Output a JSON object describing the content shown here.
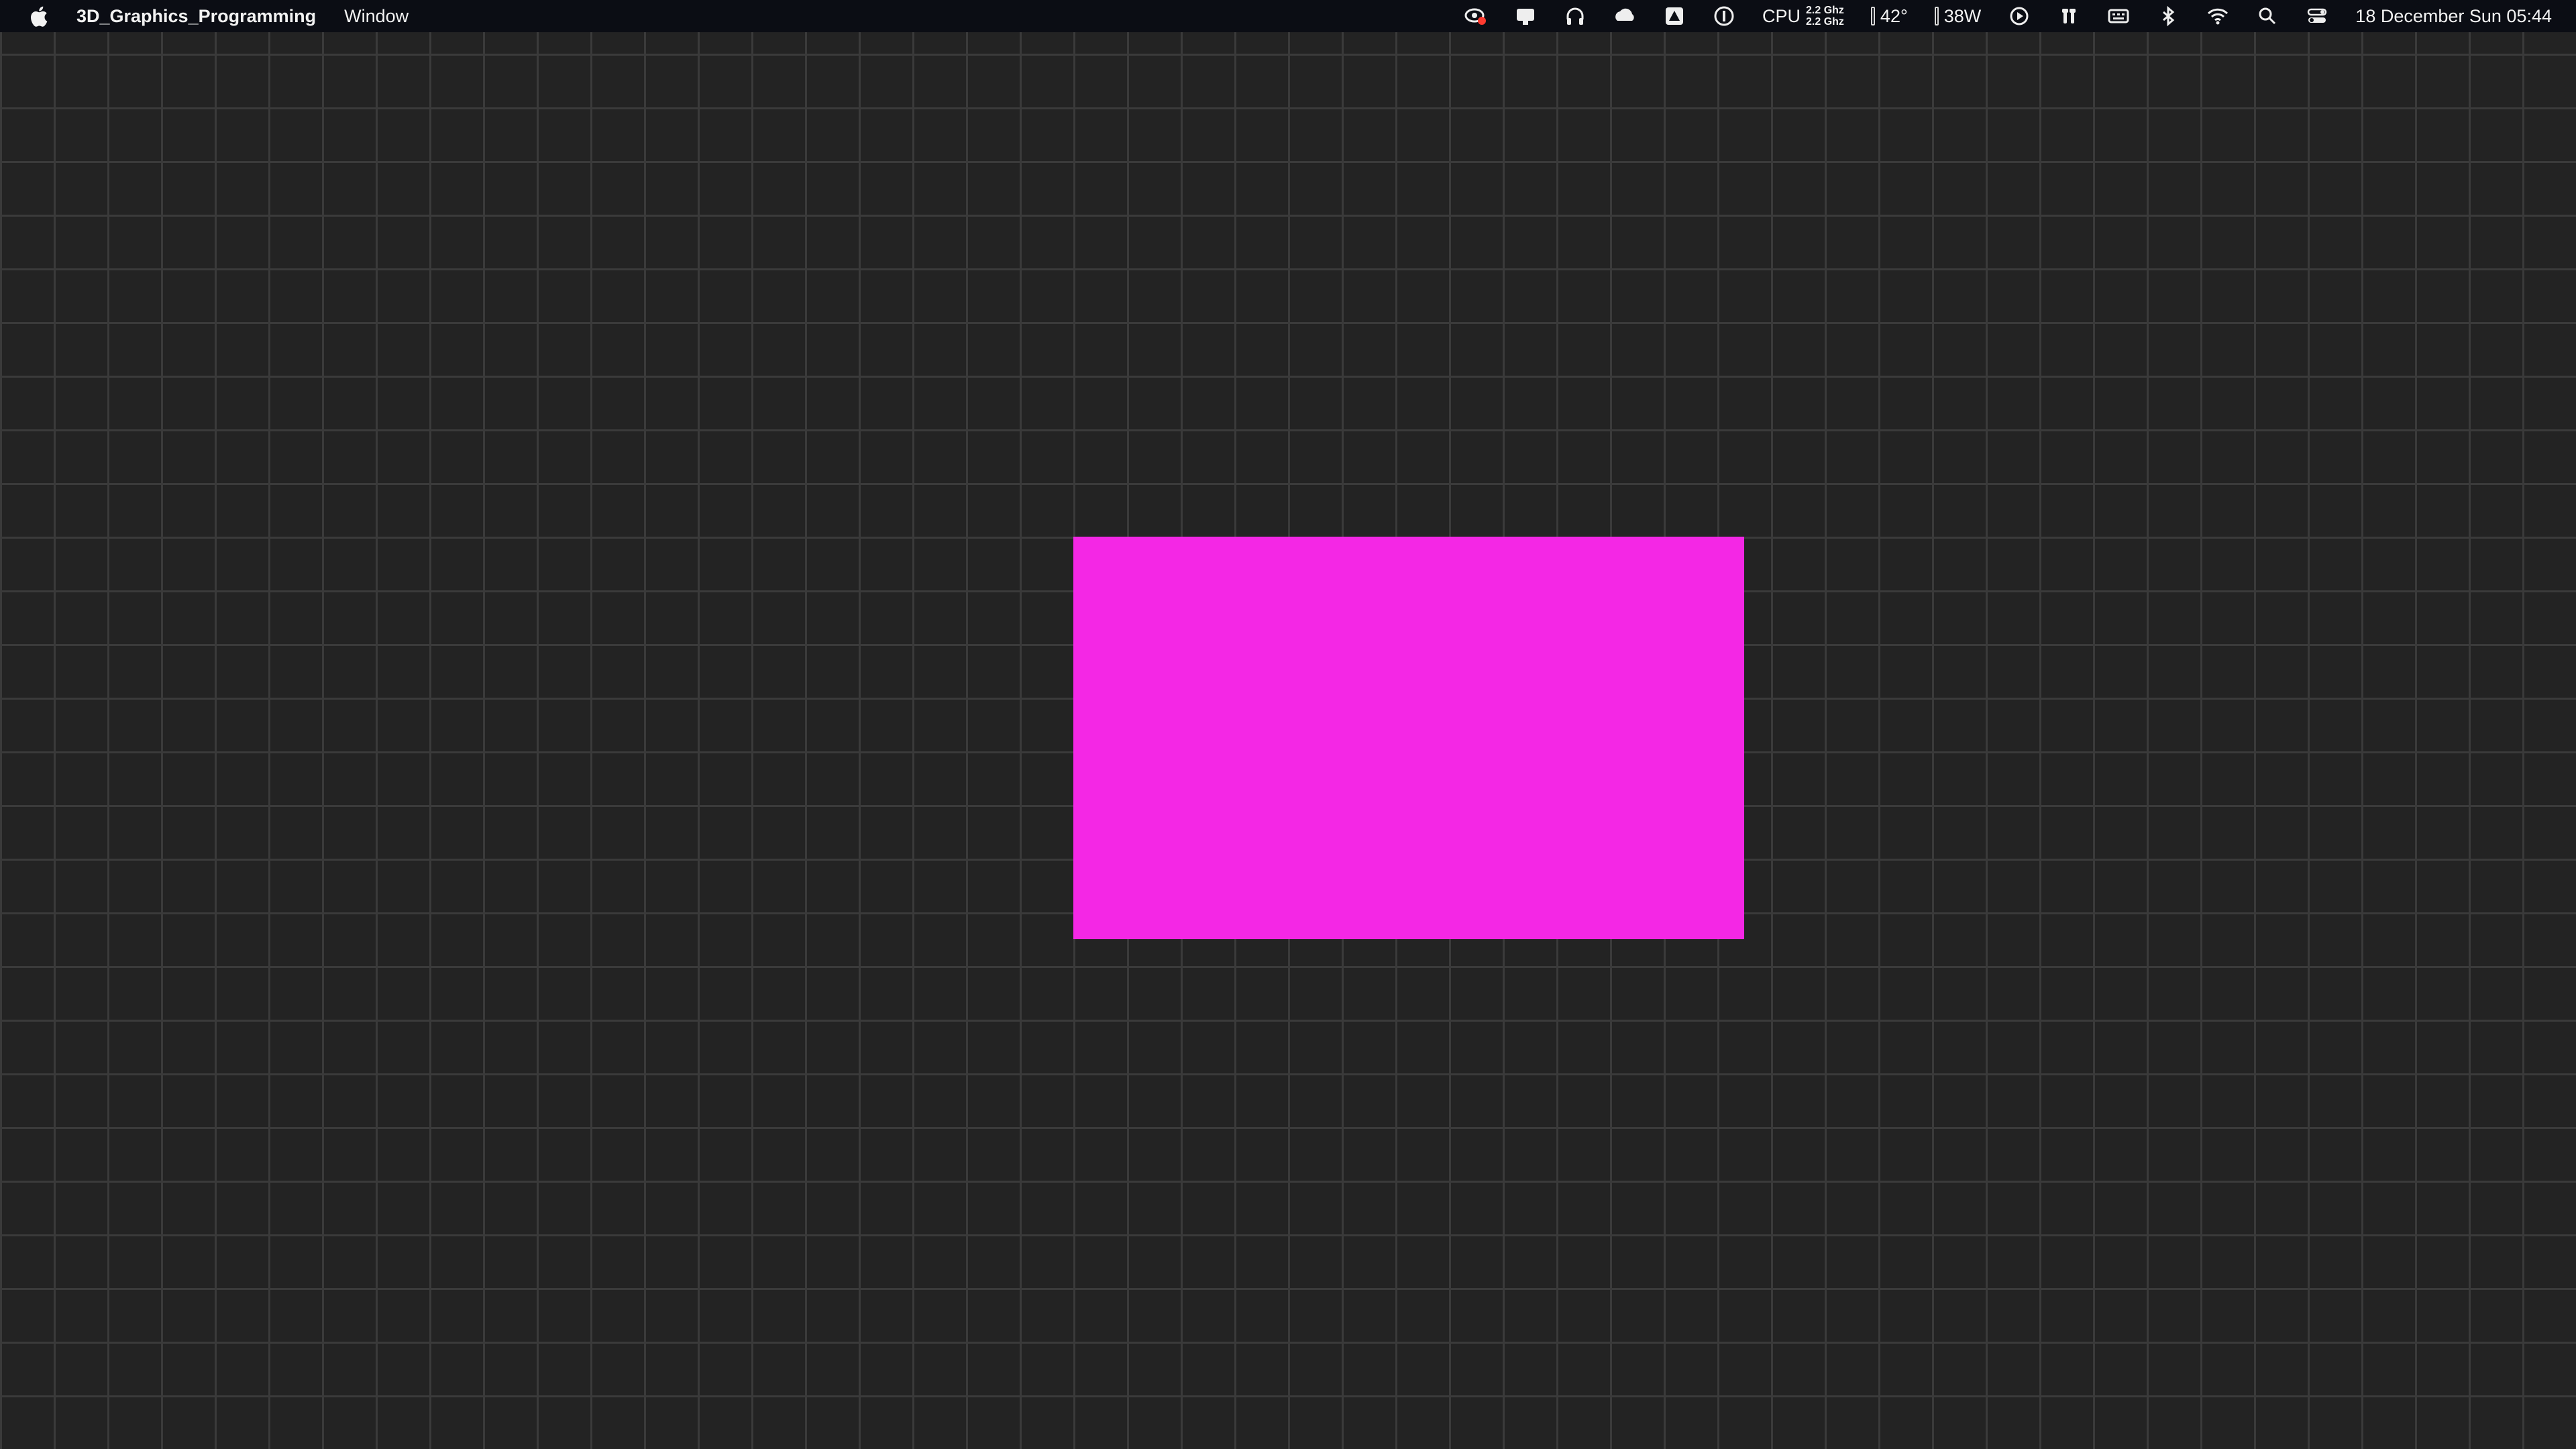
{
  "menubar": {
    "app_name": "3D_Graphics_Programming",
    "menu_items": [
      "Window"
    ],
    "status": {
      "cpu_label": "CPU",
      "cpu_freq_1": "2.2 Ghz",
      "cpu_freq_2": "2.2 Ghz",
      "temperature": "42°",
      "power": "38W",
      "datetime": "18 December Sun  05:44"
    },
    "icons": [
      "screen-record-icon",
      "notifications-icon",
      "headphones-icon",
      "cloud-icon",
      "drive-icon",
      "info-icon",
      "play-icon",
      "antenna-icon",
      "keyboard-icon",
      "bluetooth-icon",
      "wifi-icon",
      "search-icon",
      "control-center-icon"
    ]
  },
  "canvas": {
    "background_color": "#232323",
    "grid_color": "#3a3a3a",
    "shape": {
      "type": "rectangle",
      "color": "#f427e5"
    }
  }
}
